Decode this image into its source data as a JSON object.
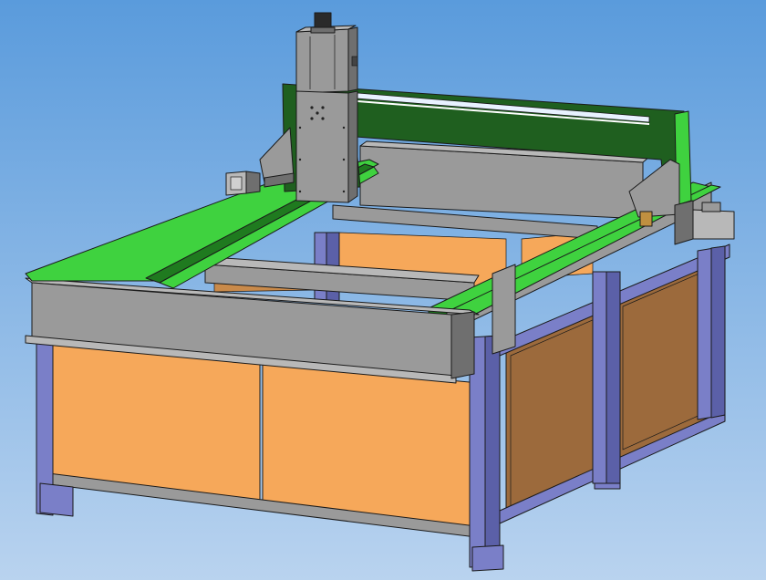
{
  "scene": {
    "subject": "",
    "background": {
      "top": "#5a9bdc",
      "bottom": "#b9d3ef"
    },
    "colors": {
      "frame_blue": "#7a7fc8",
      "frame_blue_dark": "#5b60a8",
      "panel_orange": "#f6a85a",
      "panel_orange_dark": "#9c6a3c",
      "rail_green": "#3fd23f",
      "rail_green_dark": "#1f7a1f",
      "gantry_dark_green": "#1f5f1f",
      "steel_gray": "#9a9a9a",
      "steel_gray_light": "#b8b8b8",
      "steel_gray_dark": "#6f6f6f"
    },
    "parts": {
      "spindle_motor": "spindle-motor",
      "z_axis_carriage": "z-axis-carriage",
      "gantry_beam": "gantry-beam",
      "left_rail": "left-linear-rail",
      "right_rail": "right-linear-rail",
      "front_beam": "front-i-beam",
      "stepper_motors": "stepper-motor",
      "base_frame": "base-frame",
      "side_panels": "cabinet-panels"
    }
  }
}
